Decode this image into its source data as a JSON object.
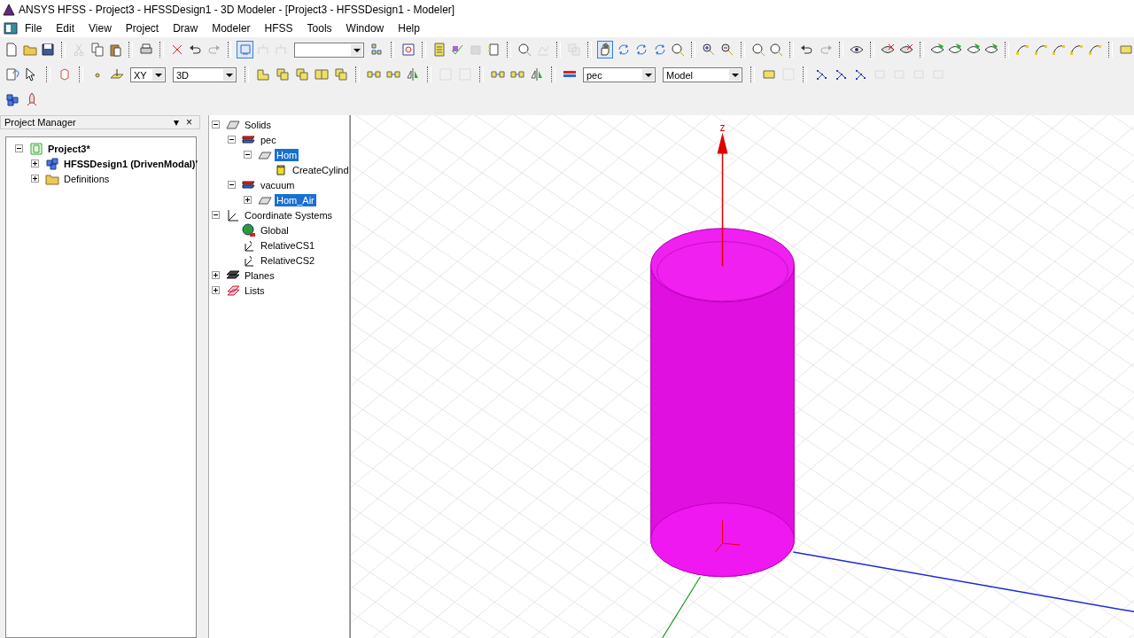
{
  "window": {
    "title": "ANSYS HFSS - Project3 - HFSSDesign1 - 3D Modeler - [Project3 - HFSSDesign1 - Modeler]"
  },
  "menu": [
    "File",
    "Edit",
    "View",
    "Project",
    "Draw",
    "Modeler",
    "HFSS",
    "Tools",
    "Window",
    "Help"
  ],
  "toolbar": {
    "plane": "XY",
    "view_mode": "3D",
    "material": "pec",
    "model": "Model"
  },
  "project_manager": {
    "title": "Project Manager",
    "pin_glyph": "▾",
    "close_glyph": "×",
    "tree": [
      {
        "label": "Project3*",
        "kind": "project",
        "bold": true,
        "expanded": true,
        "children": [
          {
            "label": "HFSSDesign1 (DrivenModal)'",
            "kind": "design",
            "bold": true,
            "expanded": false
          },
          {
            "label": "Definitions",
            "kind": "folder",
            "bold": false,
            "expanded": false
          }
        ]
      }
    ]
  },
  "model_tree": [
    {
      "label": "Solids",
      "kind": "group",
      "selected": false,
      "expanded": true,
      "children": [
        {
          "label": "pec",
          "kind": "material",
          "selected": false,
          "expanded": true,
          "children": [
            {
              "label": "Hom",
              "kind": "object",
              "selected": true,
              "expanded": true,
              "children": [
                {
                  "label": "CreateCylind",
                  "kind": "operation",
                  "selected": false
                }
              ]
            }
          ]
        },
        {
          "label": "vacuum",
          "kind": "material",
          "selected": false,
          "expanded": true,
          "children": [
            {
              "label": "Hom_Air",
              "kind": "object",
              "selected": true,
              "expanded": false
            }
          ]
        }
      ]
    },
    {
      "label": "Coordinate Systems",
      "kind": "axes",
      "selected": false,
      "expanded": true,
      "children": [
        {
          "label": "Global",
          "kind": "globe",
          "selected": false
        },
        {
          "label": "RelativeCS1",
          "kind": "cs",
          "selected": false
        },
        {
          "label": "RelativeCS2",
          "kind": "cs",
          "selected": false
        }
      ]
    },
    {
      "label": "Planes",
      "kind": "planes",
      "selected": false,
      "expanded": false
    },
    {
      "label": "Lists",
      "kind": "lists",
      "selected": false,
      "expanded": false
    }
  ],
  "viewport": {
    "axis_label": "z"
  }
}
